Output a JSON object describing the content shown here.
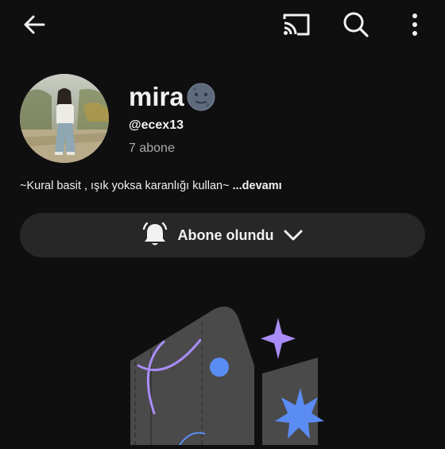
{
  "topbar": {
    "back_icon": "arrow-left-icon",
    "cast_icon": "cast-icon",
    "search_icon": "search-icon",
    "more_icon": "more-vertical-icon"
  },
  "channel": {
    "name": "mira",
    "name_emoji": "new-moon-face-emoji",
    "handle": "@ecex13",
    "subscribers": "7 abone",
    "description": "~Kural basit , ışık yoksa karanlığı kullan~",
    "description_more": "...devamı"
  },
  "subscribe_button": {
    "label": "Abone olundu",
    "bell_icon": "bell-icon",
    "chevron_icon": "chevron-down-icon"
  },
  "colors": {
    "background": "#0f0f0f",
    "button_bg": "#272727",
    "secondary_text": "#aaaaaa",
    "accent_purple": "#a98cf6",
    "accent_blue": "#5b8cf4"
  }
}
